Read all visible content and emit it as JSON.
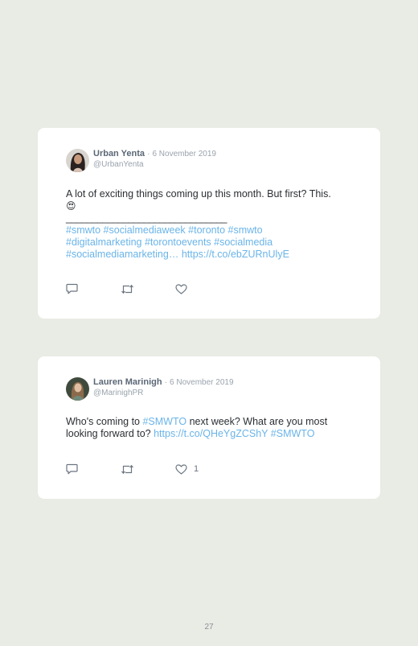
{
  "tweets": [
    {
      "name": "Urban Yenta",
      "date": "6 November 2019",
      "handle": "@UrbanYenta",
      "text_line1": "A lot of exciting things coming up this month. But first? This.",
      "emoji": "😍",
      "divider": "_______________________________",
      "hashtags_line1": "#smwto #socialmediaweek #toronto #smwto",
      "hashtags_line2": "#digitalmarketing #torontoevents #socialmedia",
      "hashtags_line3": "#socialmediamarketing…",
      "url": "https://t.co/ebZURnUlyE",
      "likes": ""
    },
    {
      "name": "Lauren Marinigh",
      "date": "6 November 2019",
      "handle": "@MarinighPR",
      "text_part1": "Who's coming to ",
      "hashtag1": "#SMWTO",
      "text_part2": " next week? What are you most looking forward to? ",
      "url": "https://t.co/QHeYgZCShY",
      "hashtag2": "#SMWTO",
      "likes": "1"
    }
  ],
  "separator": "·",
  "page_number": "27",
  "colors": {
    "background": "#e9ebe5",
    "card": "#ffffff",
    "link": "#6ab4e8",
    "name": "#5b6776",
    "muted": "#9aa3ad"
  },
  "icons": [
    "reply-icon",
    "retweet-icon",
    "heart-icon"
  ]
}
